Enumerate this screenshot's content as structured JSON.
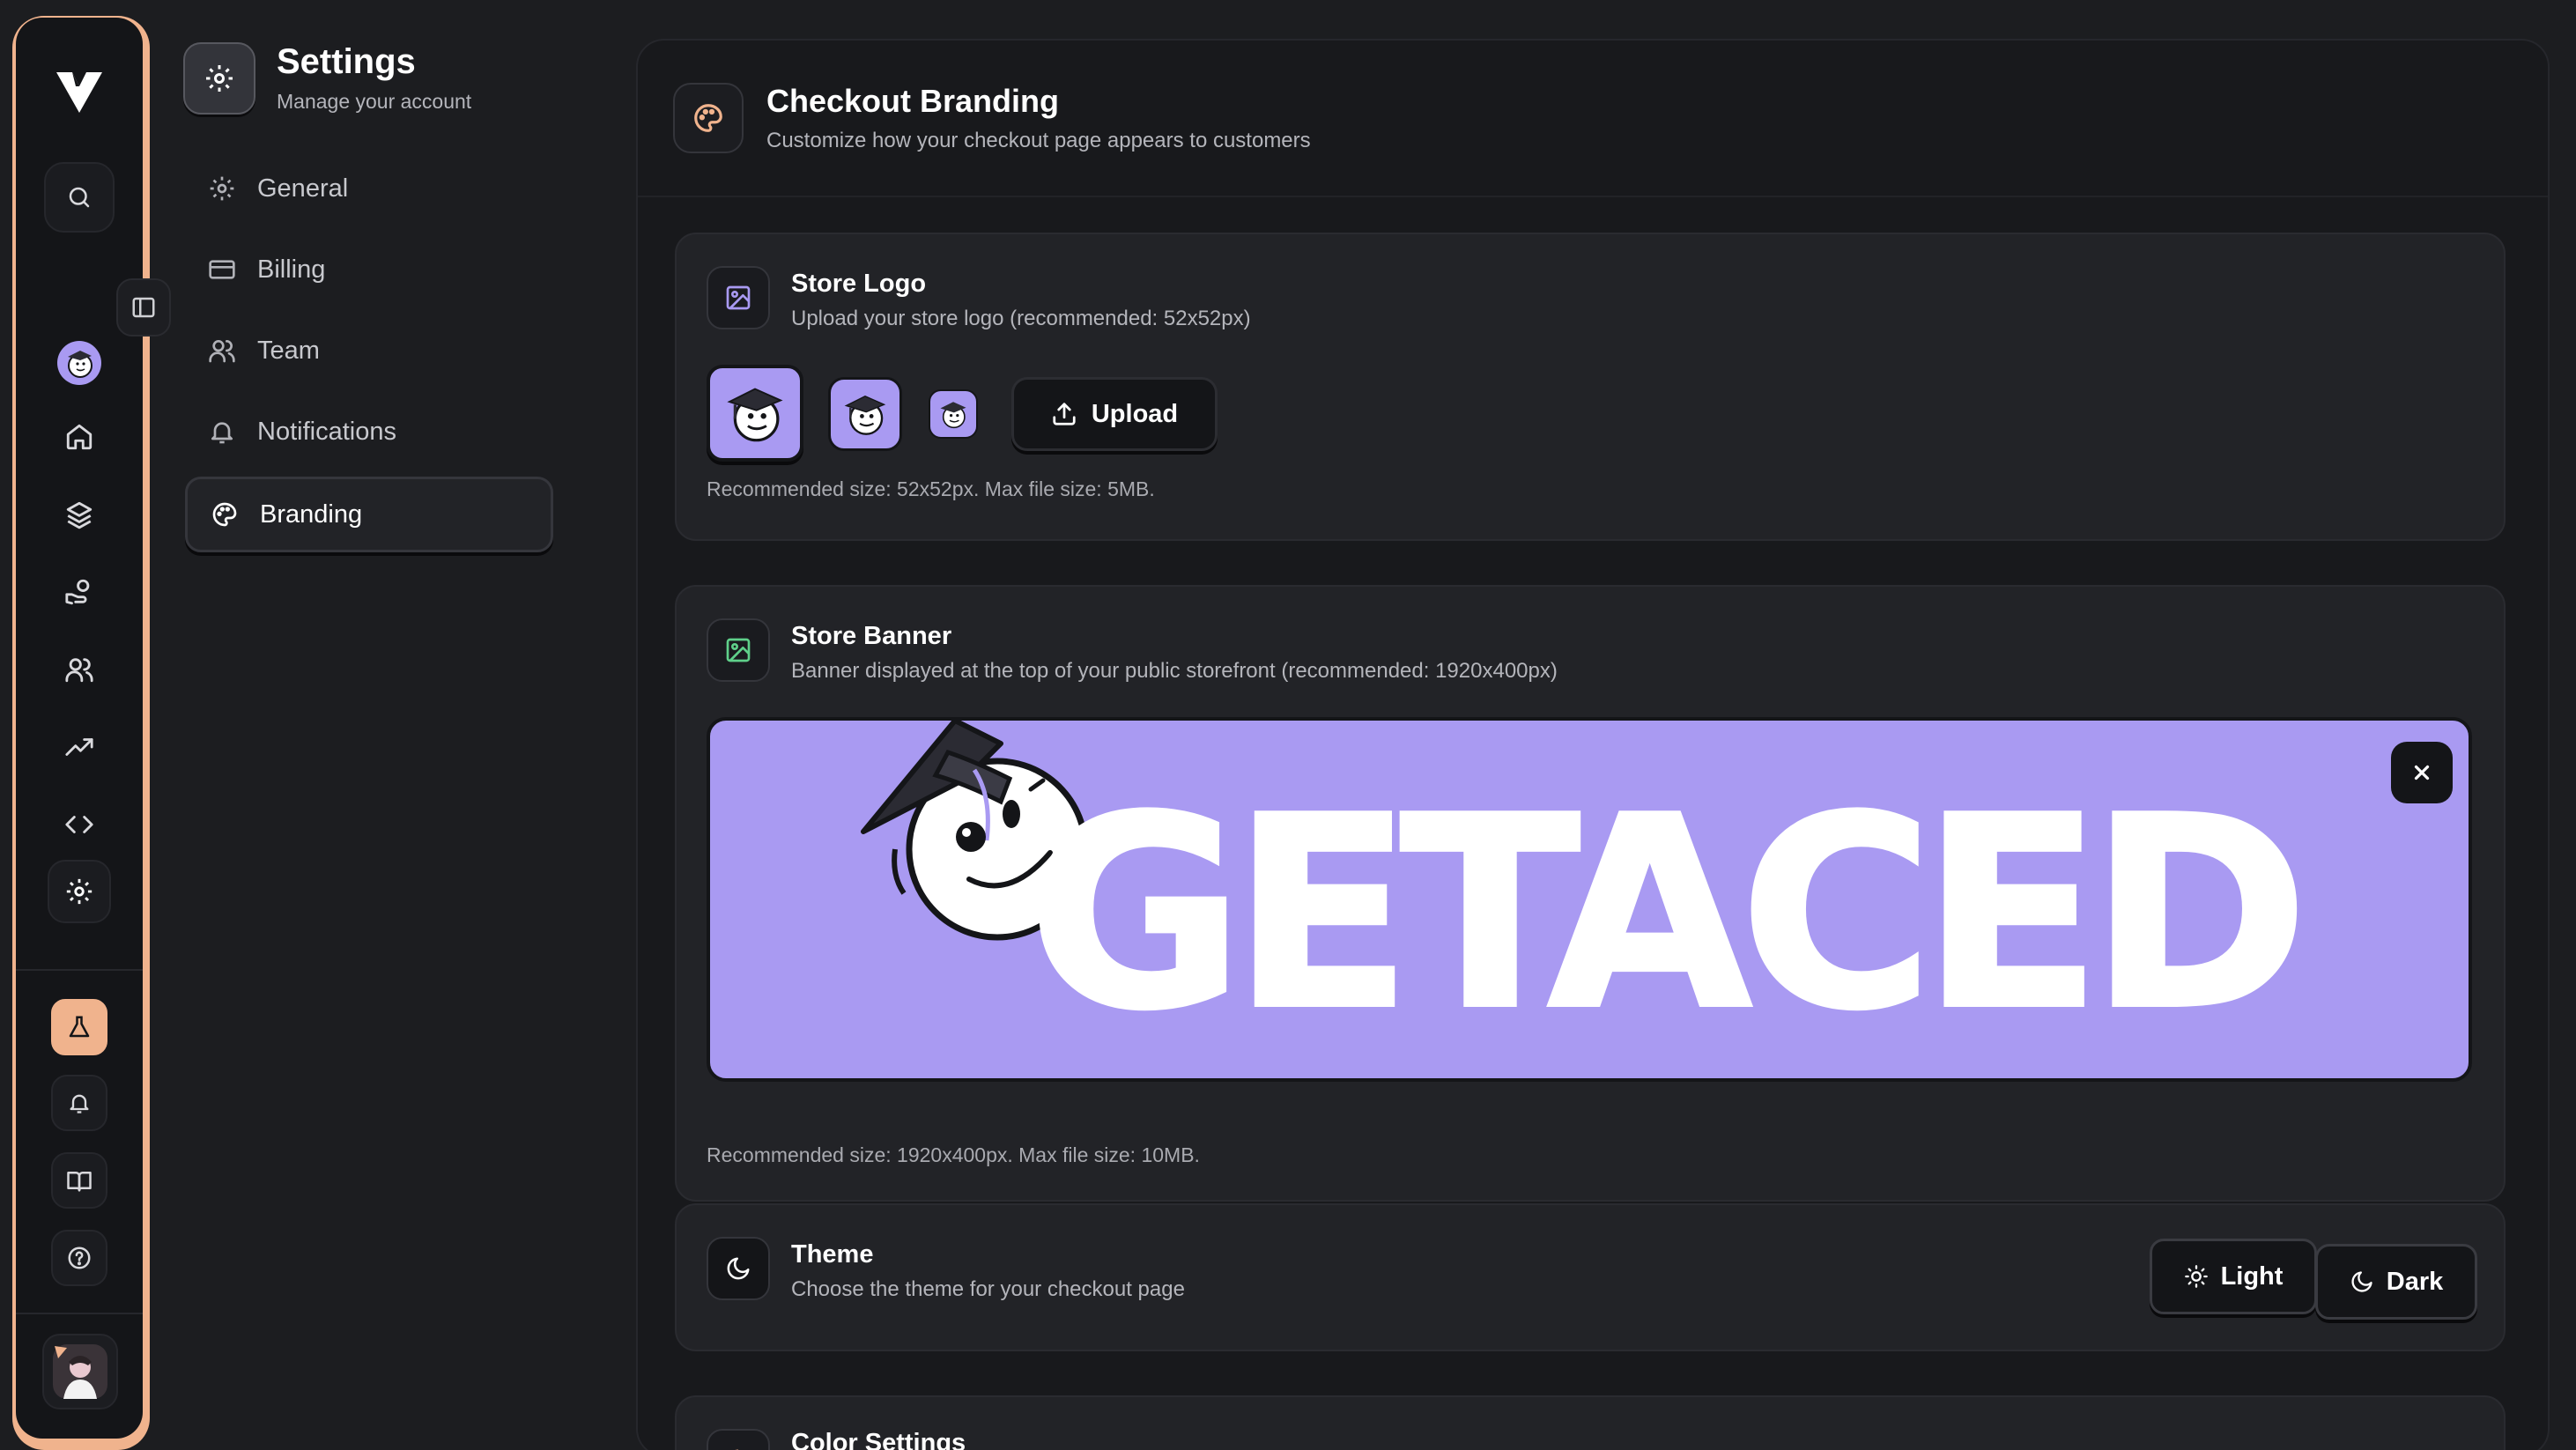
{
  "settings": {
    "title": "Settings",
    "subtitle": "Manage your account",
    "nav": [
      {
        "label": "General",
        "icon": "gear-icon"
      },
      {
        "label": "Billing",
        "icon": "credit-card-icon"
      },
      {
        "label": "Team",
        "icon": "users-icon"
      },
      {
        "label": "Notifications",
        "icon": "bell-icon"
      },
      {
        "label": "Branding",
        "icon": "palette-icon",
        "active": true
      }
    ]
  },
  "rail": {
    "logo": "V",
    "accent": "#f0b38d",
    "icons": [
      "search-icon",
      "avatar",
      "home-icon",
      "layers-icon",
      "hand-coins-icon",
      "users-icon",
      "trending-up-icon",
      "code-icon",
      "gear-icon",
      "flask-icon",
      "bell-icon",
      "book-icon",
      "help-icon",
      "user-avatar"
    ]
  },
  "main": {
    "title": "Checkout Branding",
    "subtitle": "Customize how your checkout page appears to customers"
  },
  "store_logo": {
    "title": "Store Logo",
    "subtitle": "Upload your store logo (recommended: 52x52px)",
    "upload_label": "Upload",
    "note": "Recommended size: 52x52px. Max file size: 5MB."
  },
  "store_banner": {
    "title": "Store Banner",
    "subtitle": "Banner displayed at the top of your public storefront (recommended: 1920x400px)",
    "banner_text": "GETACED",
    "note": "Recommended size: 1920x400px. Max file size: 10MB."
  },
  "theme": {
    "title": "Theme",
    "subtitle": "Choose the theme for your checkout page",
    "light_label": "Light",
    "dark_label": "Dark"
  },
  "color_settings": {
    "title": "Color Settings"
  },
  "colors": {
    "brand_purple": "#a99af2",
    "accent_peach": "#f0b38d",
    "background": "#1c1d20",
    "card": "#222327"
  }
}
